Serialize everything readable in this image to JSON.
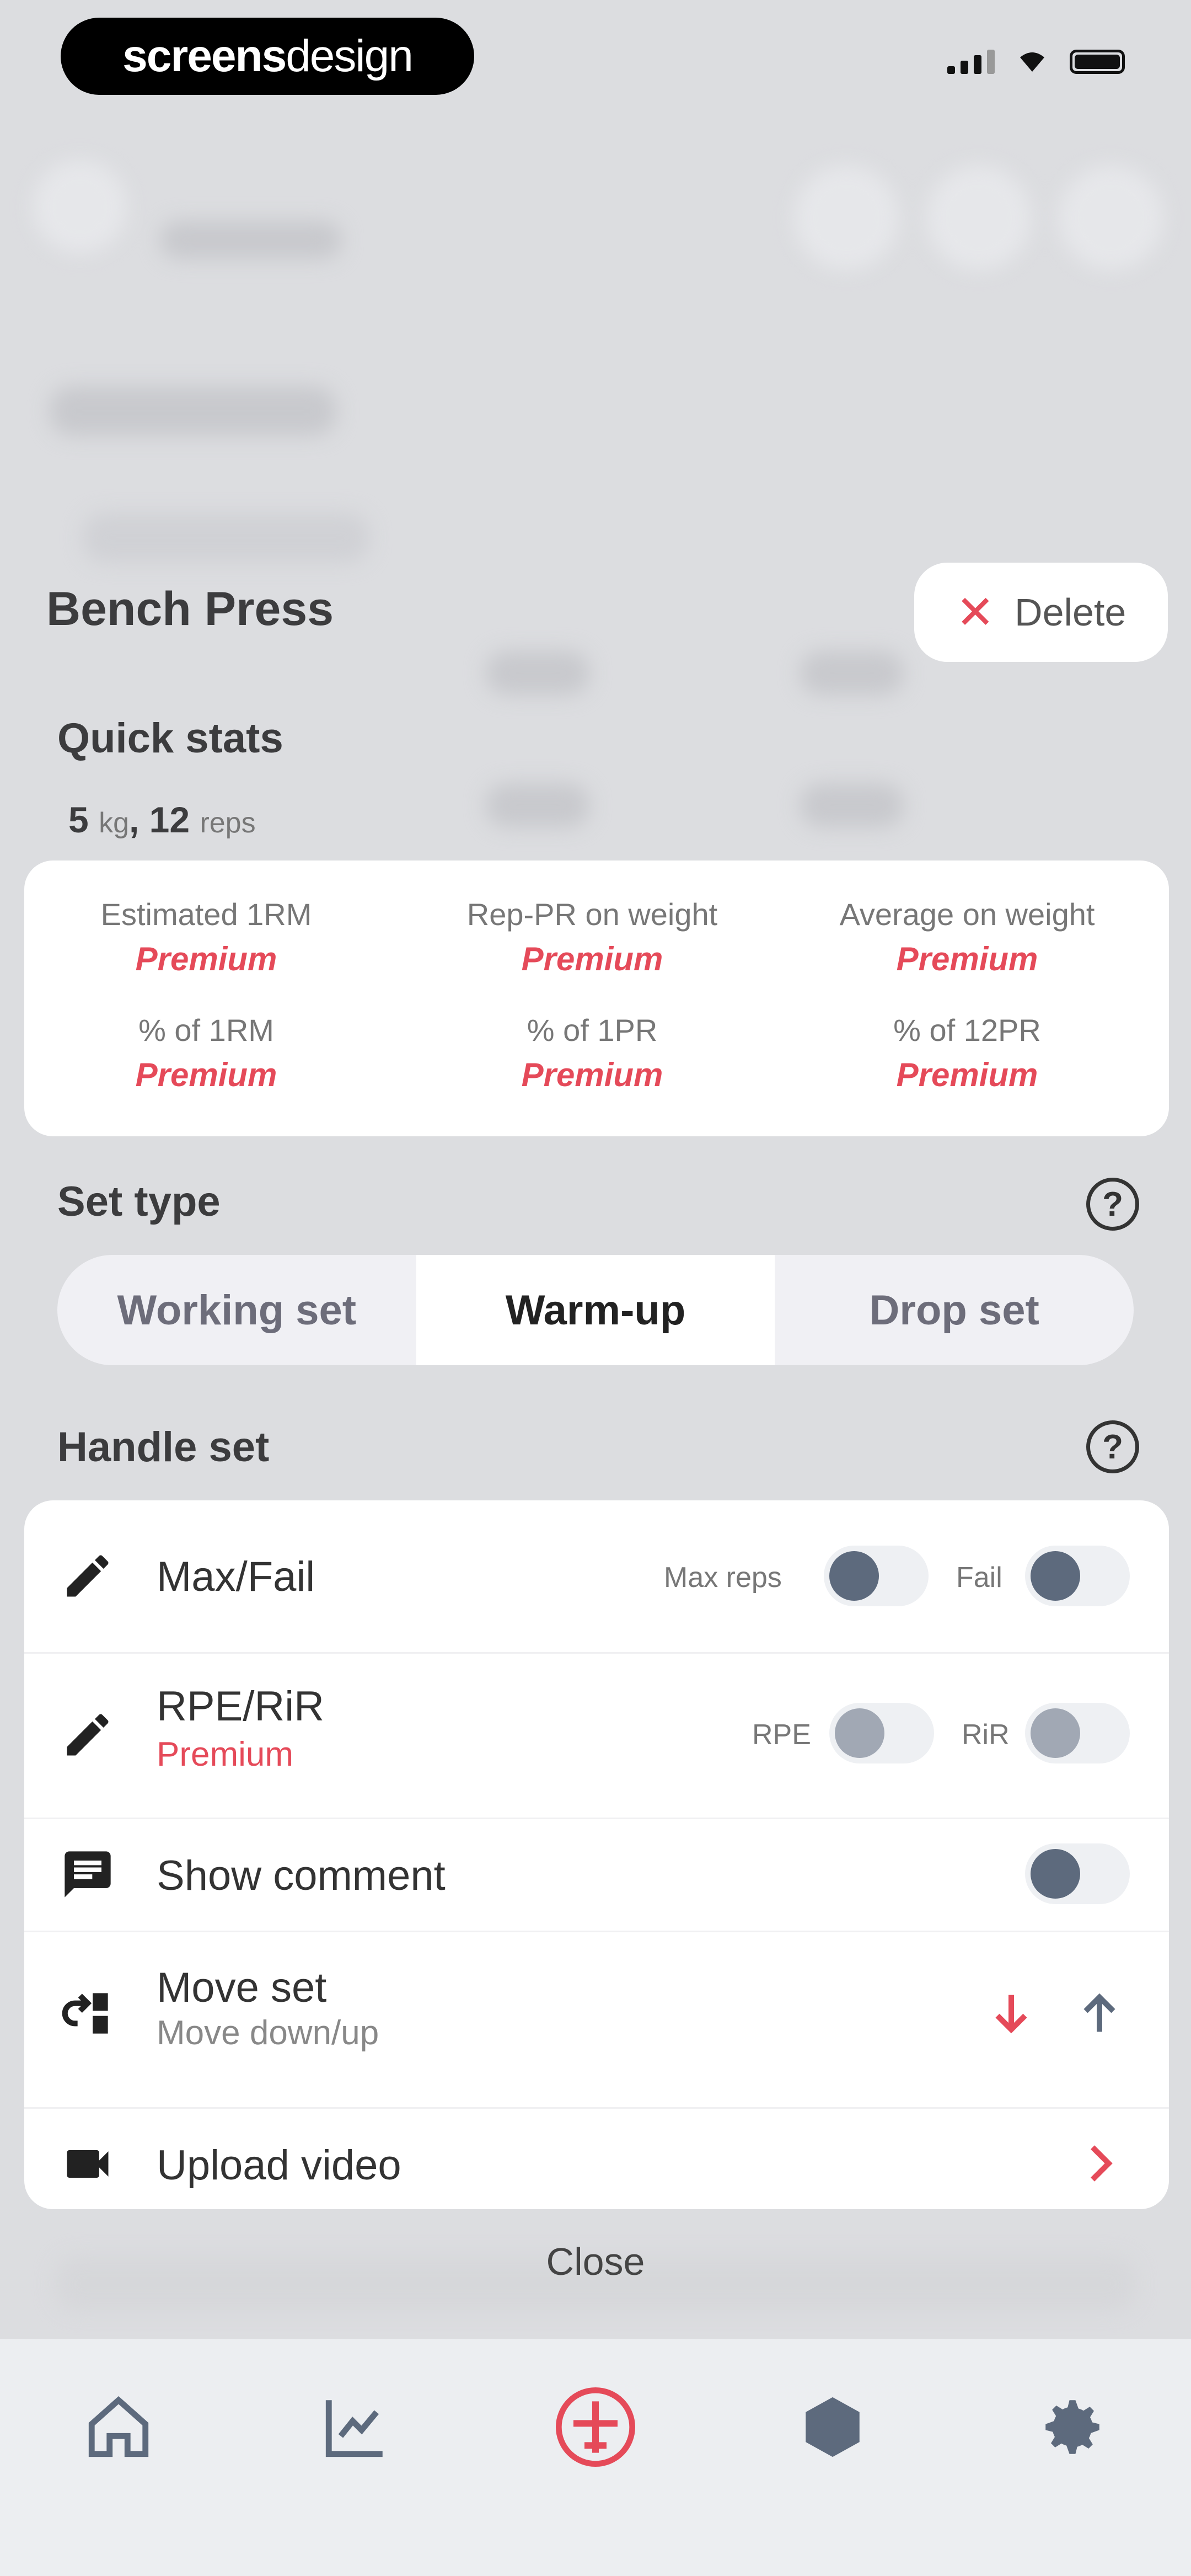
{
  "brand": {
    "text_bold": "screens",
    "text_thin": "design"
  },
  "exercise": {
    "title": "Bench Press"
  },
  "delete_button": {
    "label": "Delete",
    "icon": "close-icon"
  },
  "quick_stats": {
    "title": "Quick stats",
    "weight": "5",
    "weight_unit": "kg",
    "reps": "12",
    "reps_unit": "reps",
    "items": [
      {
        "label": "Estimated 1RM",
        "value": "Premium"
      },
      {
        "label": "Rep-PR on weight",
        "value": "Premium"
      },
      {
        "label": "Average on weight",
        "value": "Premium"
      },
      {
        "label": "% of 1RM",
        "value": "Premium"
      },
      {
        "label": "% of 1PR",
        "value": "Premium"
      },
      {
        "label": "% of 12PR",
        "value": "Premium"
      }
    ]
  },
  "set_type": {
    "title": "Set type",
    "options": [
      "Working set",
      "Warm-up",
      "Drop set"
    ],
    "selected": "Warm-up"
  },
  "handle_set": {
    "title": "Handle set",
    "max_fail": {
      "title": "Max/Fail",
      "toggle1_label": "Max reps",
      "toggle2_label": "Fail",
      "icon": "pencil-icon"
    },
    "rpe_rir": {
      "title": "RPE/RiR",
      "subtitle": "Premium",
      "toggle1_label": "RPE",
      "toggle2_label": "RiR",
      "icon": "pencil-icon"
    },
    "show_comment": {
      "title": "Show comment",
      "icon": "comment-icon"
    },
    "move_set": {
      "title": "Move set",
      "subtitle": "Move down/up",
      "icon": "move-icon"
    },
    "upload_video": {
      "title": "Upload video",
      "icon": "video-icon"
    }
  },
  "close": {
    "label": "Close"
  },
  "tabbar": {
    "items": [
      "home-icon",
      "chart-icon",
      "workout-icon",
      "box-icon",
      "settings-icon"
    ]
  },
  "colors": {
    "accent": "#e54a59",
    "toggle_knob": "#5d6a7d",
    "card_bg": "#ffffff",
    "overlay_bg": "#dcdde0"
  }
}
